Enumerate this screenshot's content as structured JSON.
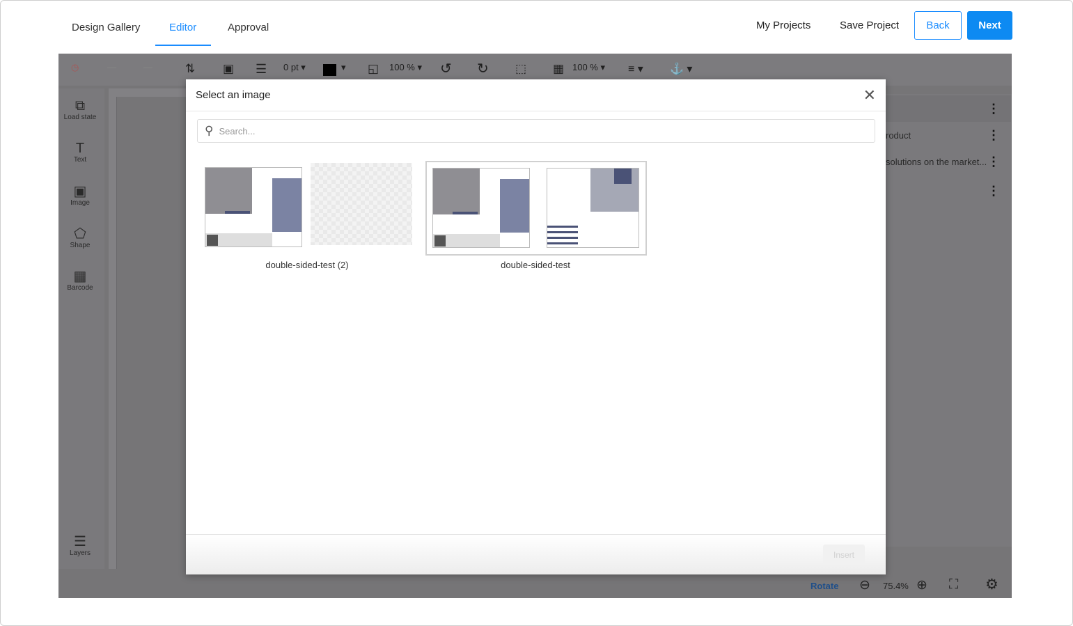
{
  "nav": {
    "tabs": [
      {
        "label": "Design Gallery"
      },
      {
        "label": "Editor",
        "active": true
      },
      {
        "label": "Approval"
      }
    ],
    "my_projects": "My Projects",
    "save_project": "Save Project",
    "back": "Back",
    "next": "Next"
  },
  "toolbar": {
    "stroke": "0 pt",
    "scale": "100 %",
    "opacity": "100 %",
    "color": "#000000"
  },
  "sidebar": {
    "items": [
      {
        "label": "Load state",
        "icon": "image-stack-icon"
      },
      {
        "label": "Text",
        "icon": "text-icon"
      },
      {
        "label": "Image",
        "icon": "image-icon"
      },
      {
        "label": "Shape",
        "icon": "shape-icon"
      },
      {
        "label": "Barcode",
        "icon": "qr-code-icon"
      },
      {
        "label": "Layers",
        "icon": "layers-icon"
      }
    ]
  },
  "right_panel": {
    "rows": [
      "",
      "roduct",
      "solutions on the market...",
      ""
    ]
  },
  "bottom": {
    "rotate": "Rotate",
    "zoom": "75.4%"
  },
  "modal": {
    "title": "Select an image",
    "search_placeholder": "Search...",
    "insert": "Insert",
    "groups": [
      {
        "label": "double-sided-test (2)",
        "selected": false
      },
      {
        "label": "double-sided-test",
        "selected": true
      }
    ]
  },
  "colors": {
    "accent": "#1a8cff",
    "next_bg": "#0d8af2"
  }
}
